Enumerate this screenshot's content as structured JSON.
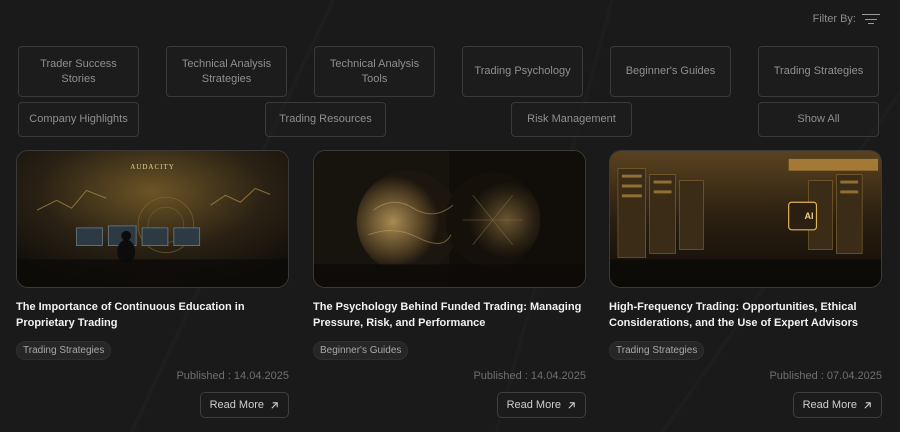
{
  "filter": {
    "label": "Filter By:",
    "icon": "filter-icon"
  },
  "categories": [
    "Trader Success Stories",
    "Technical Analysis Strategies",
    "Technical Analysis Tools",
    "Trading Psychology",
    "Beginner's Guides",
    "Trading Strategies",
    "Company Highlights",
    "Trading Resources",
    "Risk Management",
    "Show All"
  ],
  "articles": [
    {
      "title": "The Importance of Continuous Education in Proprietary Trading",
      "tag": "Trading Strategies",
      "published": "Published : 14.04.2025",
      "read_more": "Read More",
      "image_logo": "AUDACITY"
    },
    {
      "title": "The Psychology Behind Funded Trading: Managing Pressure, Risk, and Performance",
      "tag": "Beginner's Guides",
      "published": "Published : 14.04.2025",
      "read_more": "Read More"
    },
    {
      "title": "High-Frequency Trading: Opportunities, Ethical Considerations, and the Use of Expert Advisors",
      "tag": "Trading Strategies",
      "published": "Published : 07.04.2025",
      "read_more": "Read More",
      "image_label": "AI"
    }
  ],
  "colors": {
    "background": "#1a1a1a",
    "border": "#3a3a3a",
    "gold": "#c9a24a"
  }
}
